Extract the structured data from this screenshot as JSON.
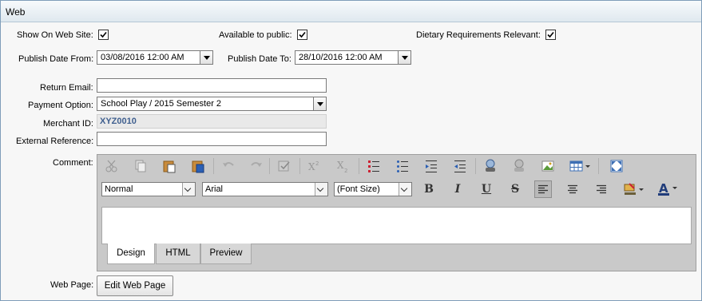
{
  "panel": {
    "title": "Web"
  },
  "row1": {
    "show_on_web_label": "Show On Web Site:",
    "show_on_web_checked": true,
    "available_public_label": "Available to public:",
    "available_public_checked": true,
    "dietary_label": "Dietary Requirements Relevant:",
    "dietary_checked": true
  },
  "row2": {
    "publish_from_label": "Publish Date From:",
    "publish_from_value": "03/08/2016 12:00 AM",
    "publish_to_label": "Publish Date To:",
    "publish_to_value": "28/10/2016 12:00 AM"
  },
  "fields": {
    "return_email_label": "Return Email:",
    "return_email_value": "",
    "payment_option_label": "Payment Option:",
    "payment_option_value": "School Play / 2015 Semester 2",
    "merchant_id_label": "Merchant ID:",
    "merchant_id_value": "XYZ0010",
    "external_ref_label": "External Reference:",
    "external_ref_value": "",
    "comment_label": "Comment:",
    "web_page_label": "Web Page:"
  },
  "editor": {
    "toolbar1_icons": [
      "cut-icon",
      "copy-icon",
      "paste-icon",
      "paste-word-icon",
      "undo-icon",
      "redo-icon",
      "spellcheck-icon",
      "superscript-icon",
      "subscript-icon",
      "ordered-list-icon",
      "unordered-list-icon",
      "indent-icon",
      "outdent-icon",
      "link-icon",
      "unlink-icon",
      "image-icon",
      "table-icon",
      "fullscreen-icon"
    ],
    "paragraph_format": "Normal",
    "font_name": "Arial",
    "font_size": "(Font Size)",
    "bold_label": "B",
    "italic_label": "I",
    "underline_label": "U",
    "strike_label": "S",
    "font_color_label": "A",
    "tabs": [
      "Design",
      "HTML",
      "Preview"
    ],
    "active_tab": "Design"
  },
  "buttons": {
    "edit_web_page": "Edit Web Page"
  }
}
